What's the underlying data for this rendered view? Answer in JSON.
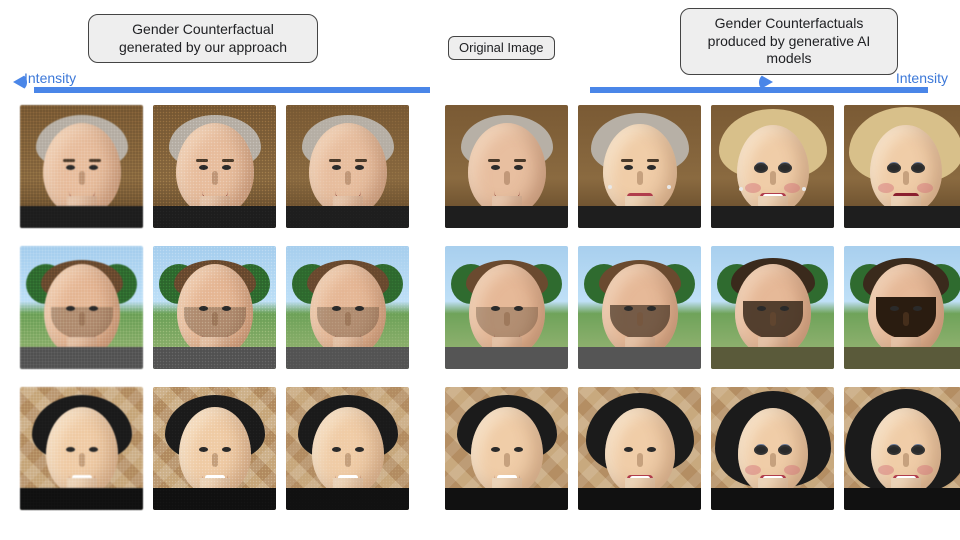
{
  "header": {
    "left_caption": "Gender Counterfactual\ngenerated by our approach",
    "center_caption": "Original Image",
    "right_caption": "Gender Counterfactuals\nproduced by generative AI\nmodels",
    "intensity_label_left": "Intensity",
    "intensity_label_right": "Intensity",
    "arrow_color": "#4a86e8"
  },
  "grid": {
    "rows": 3,
    "cols": 7,
    "column_roles": [
      "ours-3",
      "ours-2",
      "ours-1",
      "original",
      "gen-1",
      "gen-2",
      "gen-3"
    ],
    "left_intensity_direction": "increasing-to-left",
    "right_intensity_direction": "increasing-to-right",
    "subjects": [
      {
        "id": "row1",
        "background": "brown-curtain",
        "original": {
          "gender_presentation": "male",
          "age": "older",
          "hair": "grey",
          "shirt": "dark"
        },
        "ours_note": "adversarial-noise variants of original; visual change minimal, noise increases leftward",
        "genai_note": "progressive feminisation rightward: softer features, styled blonde hair, makeup, earrings"
      },
      {
        "id": "row2",
        "background": "outdoor-sky-trees",
        "original": {
          "gender_presentation": "male",
          "age": "adult",
          "hair": "brown-short",
          "facial_hair": "light-stubble",
          "shirt": "grey"
        },
        "ours_note": "adversarial-noise variants of original",
        "genai_note": "progressive masculinisation rightward: heavier beard, darker hair"
      },
      {
        "id": "row3",
        "background": "geometric-tile",
        "original": {
          "gender_presentation": "female",
          "age": "adult",
          "hair": "black-short",
          "shirt": "black"
        },
        "ours_note": "adversarial-noise variants of original",
        "genai_note": "progressive feminisation rightward: longer hair, brighter smile, makeup"
      }
    ]
  }
}
